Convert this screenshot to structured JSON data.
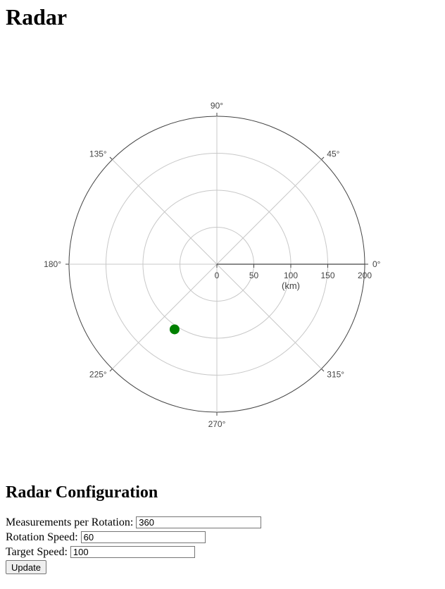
{
  "page": {
    "title": "Radar"
  },
  "chart_data": {
    "type": "scatter",
    "coordinate_system": "polar",
    "radial_unit_label": "(km)",
    "radial_range": [
      0,
      200
    ],
    "radial_ticks": [
      "0",
      "50",
      "100",
      "150",
      "200"
    ],
    "radial_tick_values": [
      0,
      50,
      100,
      150,
      200
    ],
    "angular_ticks": [
      "0°",
      "45°",
      "90°",
      "135°",
      "180°",
      "225°",
      "270°",
      "315°"
    ],
    "angular_tick_values": [
      0,
      45,
      90,
      135,
      180,
      225,
      270,
      315
    ],
    "grid": true,
    "sweep_angle_deg": 0,
    "points": [
      {
        "r": 105,
        "theta": 237,
        "color": "#008000"
      }
    ]
  },
  "config": {
    "heading": "Radar Configuration",
    "fields": [
      {
        "label": "Measurements per Rotation:",
        "value": "360"
      },
      {
        "label": "Rotation Speed:",
        "value": "60"
      },
      {
        "label": "Target Speed:",
        "value": "100"
      }
    ],
    "button_label": "Update"
  }
}
